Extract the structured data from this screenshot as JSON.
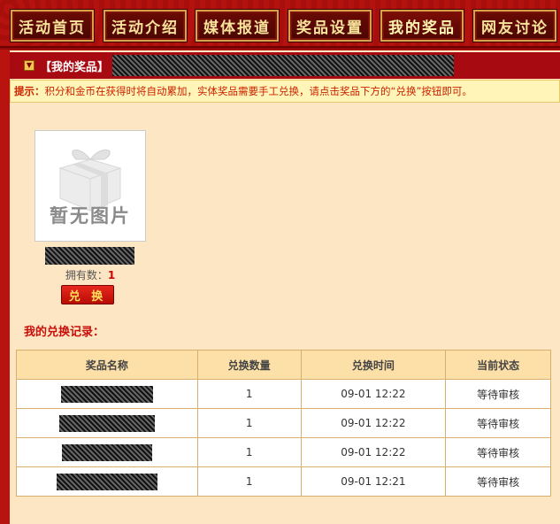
{
  "nav": {
    "items": [
      {
        "label": "活动首页",
        "active": false
      },
      {
        "label": "活动介绍",
        "active": false
      },
      {
        "label": "媒体报道",
        "active": false
      },
      {
        "label": "奖品设置",
        "active": false
      },
      {
        "label": "我的奖品",
        "active": true
      },
      {
        "label": "网友讨论",
        "active": false
      }
    ]
  },
  "section": {
    "title": "【我的奖品】"
  },
  "notice": {
    "label": "提示：",
    "text": "积分和金币在获得时将自动累加，实体奖品需要手工兑换，请点击奖品下方的“兑换”按钮即可。"
  },
  "prize": {
    "no_image_text": "暂无图片",
    "owned_label": "拥有数：",
    "owned_count": "1",
    "exchange_label": "兑 换"
  },
  "records": {
    "title": "我的兑换记录：",
    "columns": [
      "奖品名称",
      "兑换数量",
      "兑换时间",
      "当前状态"
    ],
    "rows": [
      {
        "qty": "1",
        "time": "09-01 12:22",
        "status": "等待审核"
      },
      {
        "qty": "1",
        "time": "09-01 12:22",
        "status": "等待审核"
      },
      {
        "qty": "1",
        "time": "09-01 12:22",
        "status": "等待审核"
      },
      {
        "qty": "1",
        "time": "09-01 12:21",
        "status": "等待审核"
      }
    ]
  },
  "colors": {
    "brand_red": "#a80a12",
    "notice_bg": "#fff5b8",
    "status_red": "#d21a1a",
    "nav_gold": "#f7e39a"
  }
}
